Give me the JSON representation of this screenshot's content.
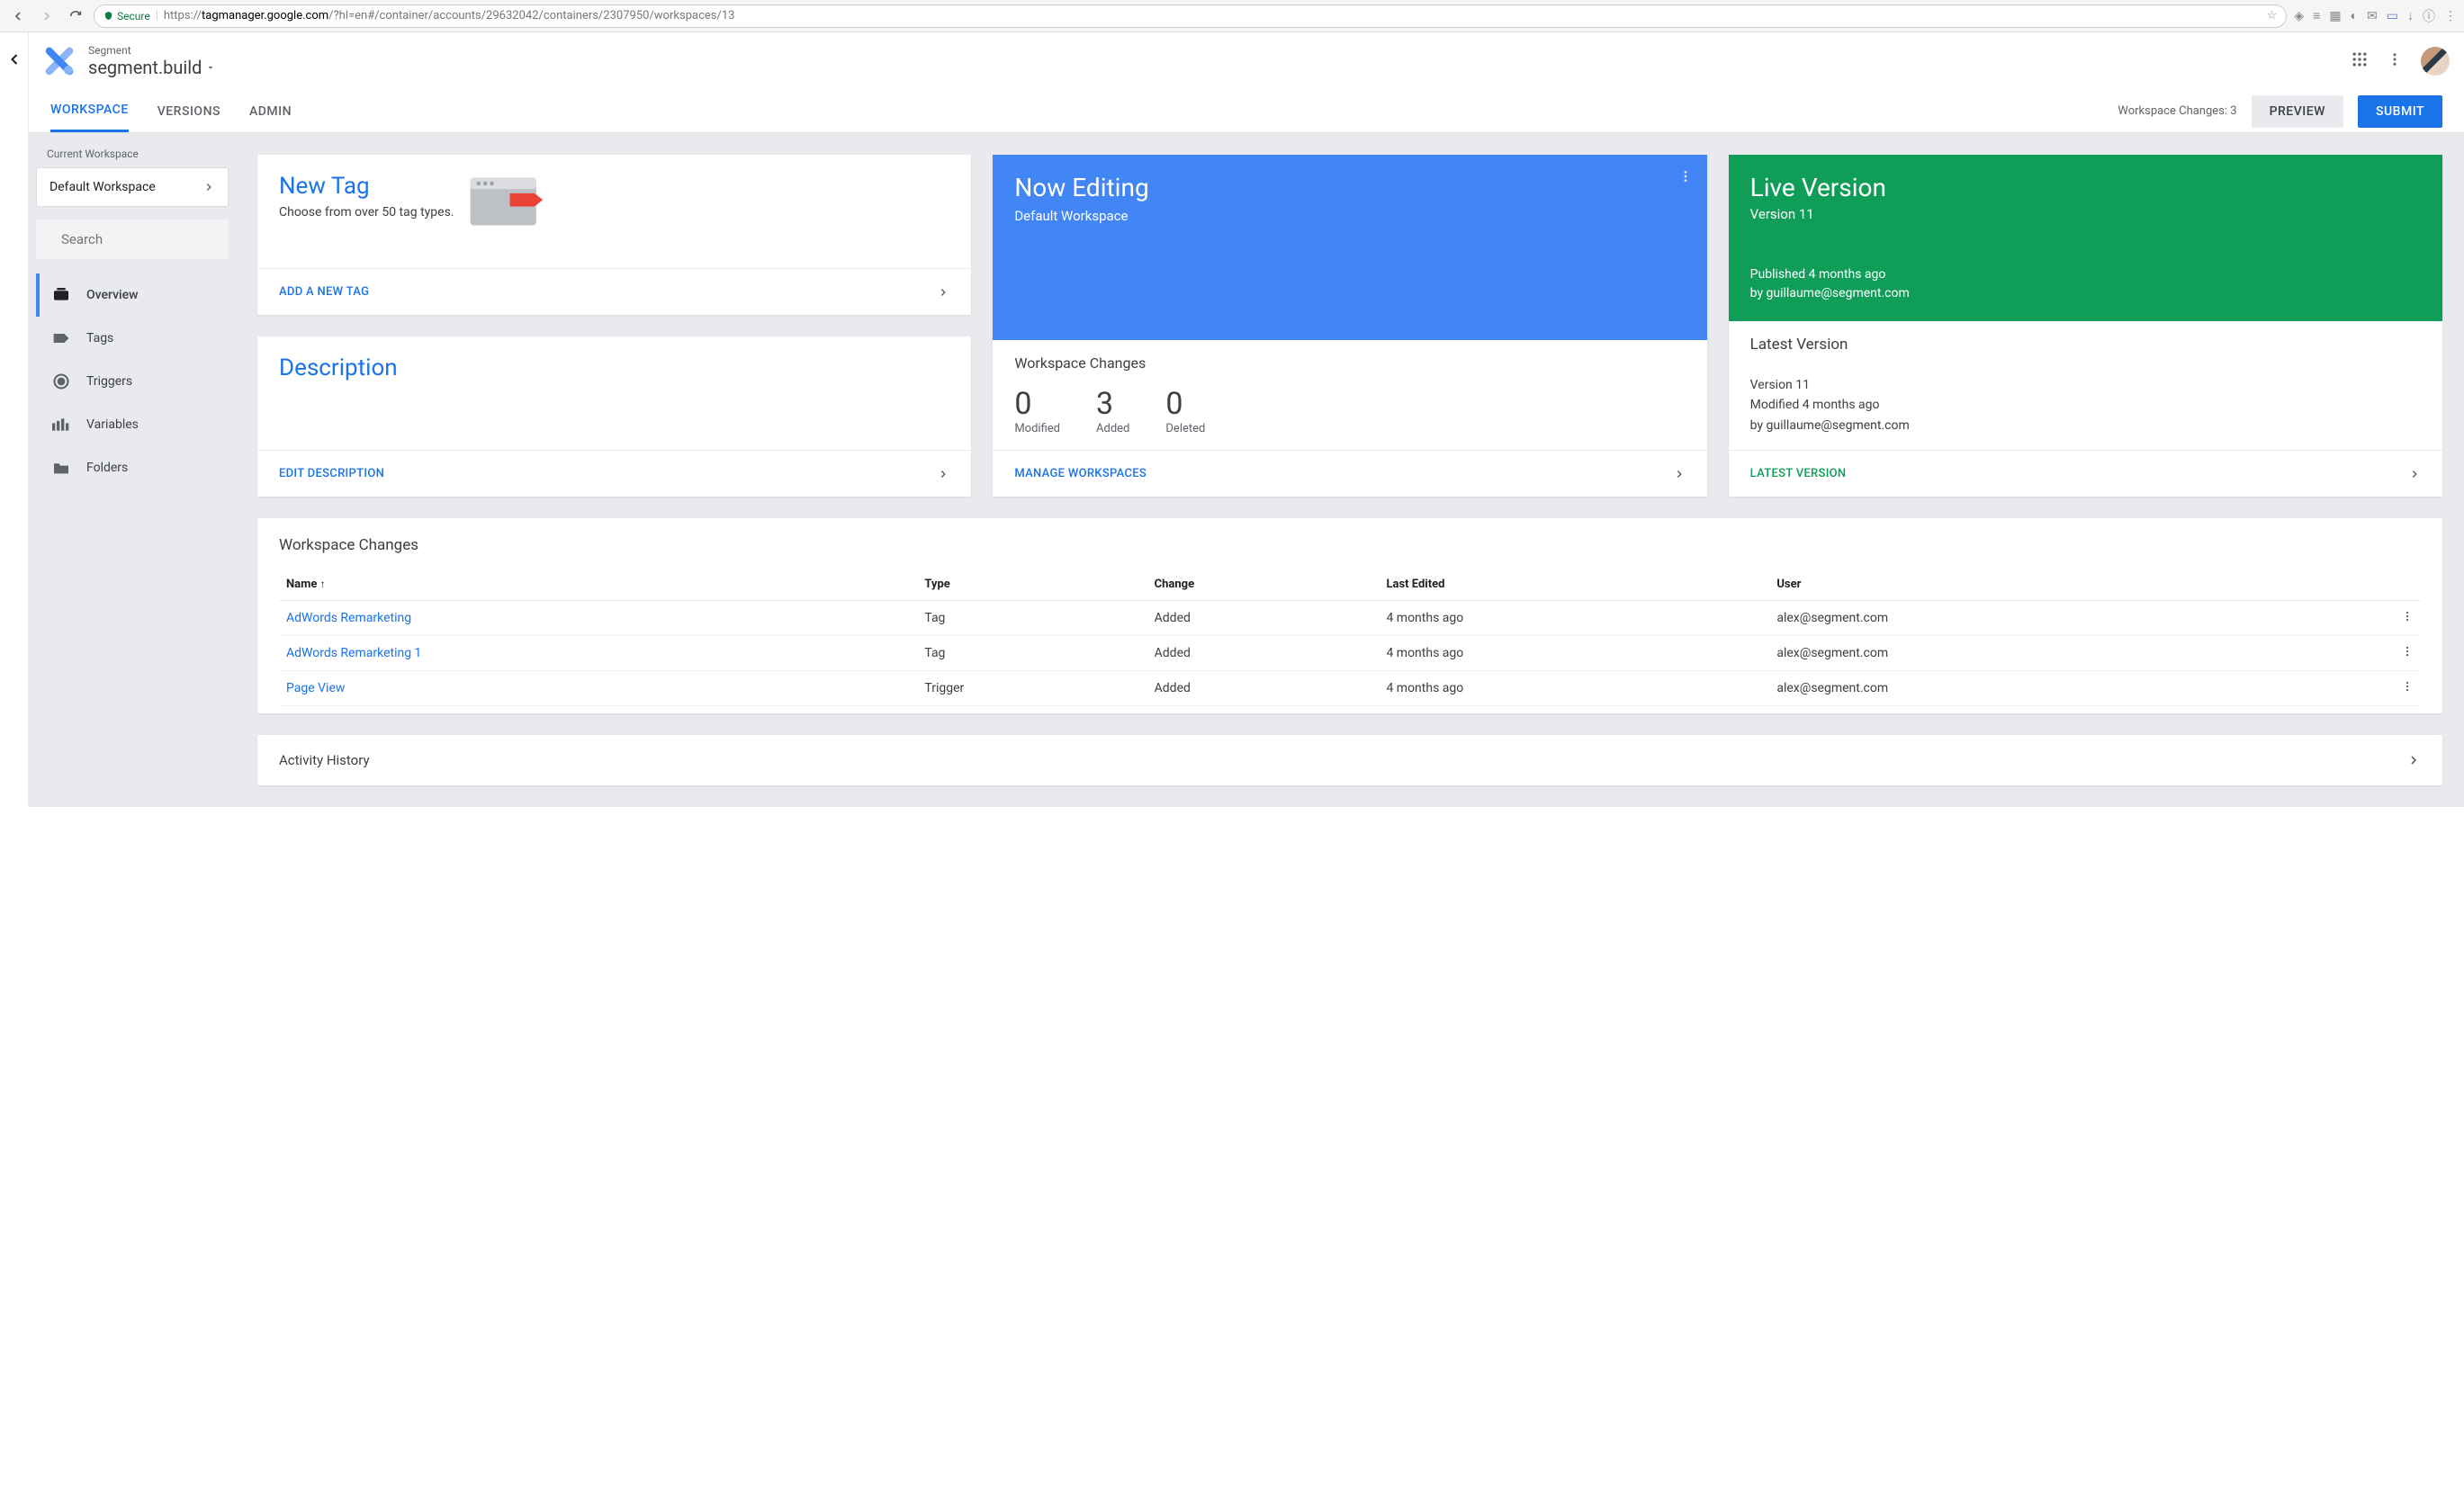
{
  "browser": {
    "secure_label": "Secure",
    "url_proto": "https://",
    "url_domain": "tagmanager.google.com",
    "url_path": "/?hl=en#/container/accounts/29632042/containers/2307950/workspaces/13"
  },
  "header": {
    "breadcrumb": "Segment",
    "title": "segment.build"
  },
  "tabs": {
    "workspace": "WORKSPACE",
    "versions": "VERSIONS",
    "admin": "ADMIN",
    "changes_label": "Workspace Changes: 3",
    "preview": "PREVIEW",
    "submit": "SUBMIT"
  },
  "sidebar": {
    "current_label": "Current Workspace",
    "workspace_name": "Default Workspace",
    "search_placeholder": "Search",
    "items": {
      "overview": "Overview",
      "tags": "Tags",
      "triggers": "Triggers",
      "variables": "Variables",
      "folders": "Folders"
    }
  },
  "newtag": {
    "title": "New Tag",
    "subtitle": "Choose from over 50 tag types.",
    "action": "ADD A NEW TAG"
  },
  "description": {
    "title": "Description",
    "action": "EDIT DESCRIPTION"
  },
  "editing": {
    "title": "Now Editing",
    "workspace": "Default Workspace",
    "section_title": "Workspace Changes",
    "modified_count": "0",
    "modified_label": "Modified",
    "added_count": "3",
    "added_label": "Added",
    "deleted_count": "0",
    "deleted_label": "Deleted",
    "action": "MANAGE WORKSPACES"
  },
  "live": {
    "title": "Live Version",
    "version": "Version 11",
    "published_line": "Published 4 months ago",
    "by_line": "by guillaume@segment.com",
    "latest_title": "Latest Version",
    "latest_version": "Version 11",
    "latest_modified": "Modified 4 months ago",
    "latest_by": "by guillaume@segment.com",
    "action": "LATEST VERSION"
  },
  "changes_table": {
    "title": "Workspace Changes",
    "headers": {
      "name": "Name",
      "type": "Type",
      "change": "Change",
      "last_edited": "Last Edited",
      "user": "User"
    },
    "rows": [
      {
        "name": "AdWords Remarketing",
        "type": "Tag",
        "change": "Added",
        "last_edited": "4 months ago",
        "user": "alex@segment.com"
      },
      {
        "name": "AdWords Remarketing 1",
        "type": "Tag",
        "change": "Added",
        "last_edited": "4 months ago",
        "user": "alex@segment.com"
      },
      {
        "name": "Page View",
        "type": "Trigger",
        "change": "Added",
        "last_edited": "4 months ago",
        "user": "alex@segment.com"
      }
    ]
  },
  "activity": {
    "title": "Activity History"
  }
}
